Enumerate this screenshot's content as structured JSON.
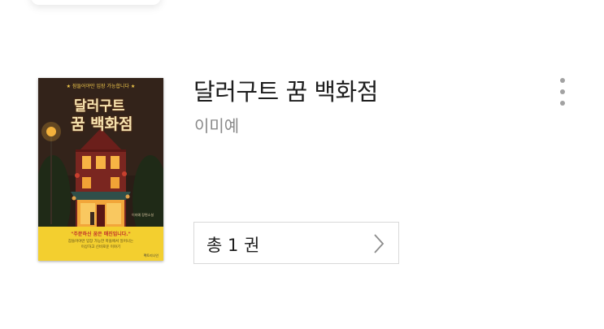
{
  "book": {
    "title": "달러구트 꿈 백화점",
    "author": "이미예",
    "cover": {
      "tagline": "★ 잠들어야만 입장 가능합니다 ★",
      "title_line1": "달러구트",
      "title_line2": "꿈 백화점",
      "band_headline": "\"주문하신 꿈은 매진입니다.\"",
      "band_text_line1": "잠들어야만 입장 가능한 마을에서 일어나는",
      "band_text_line2": "이상하고 신비로운 이야기",
      "small_author": "이미예 장편소설",
      "publisher": "팩토리나인",
      "colors": {
        "background": "#2a1d16",
        "title": "#f6e3b0",
        "band": "#f3cf2f",
        "band_headline": "#c0302a"
      }
    }
  },
  "more_button": {
    "icon": "vertical-ellipsis-icon"
  },
  "volume_button": {
    "label": "총 1 권",
    "icon": "chevron-right-icon"
  }
}
